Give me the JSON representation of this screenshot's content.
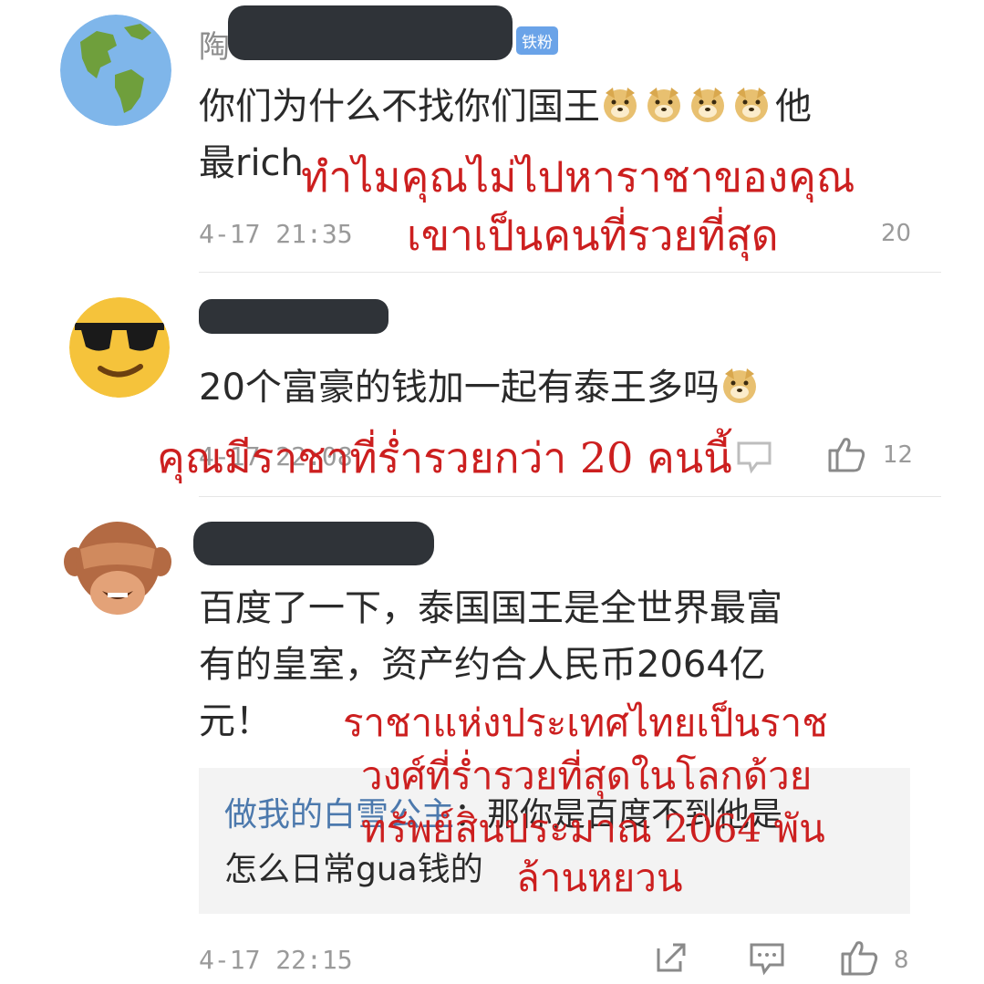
{
  "comments": [
    {
      "name_visible": "陶",
      "badge": "铁粉",
      "text_line1": "你们为什么不找你们国王",
      "text_line1_after": "他",
      "text_line2": "最rich",
      "time": "4-17 21:35",
      "likes": "20",
      "emoji": "doge",
      "translation_line1": "ทำไมคุณไม่ไปหาราชาของคุณ",
      "translation_line2": "เขาเป็นคนที่รวยที่สุด"
    },
    {
      "name_visible": "",
      "text_line1": "20个富豪的钱加一起有泰王多吗",
      "time": "4-17 22:08",
      "likes": "12",
      "emoji": "doge",
      "translation_line1": "คุณมีราชาที่ร่ำรวยกว่า 20 คนนี้"
    },
    {
      "name_visible": "",
      "text_line1": "百度了一下，泰国国王是全世界最富",
      "text_line2": "有的皇室，资产约合人民币2064亿",
      "text_line3": "元！",
      "time": "4-17 22:15",
      "likes": "8",
      "translation_line1": "ราชาแห่งประเทศไทยเป็นราช",
      "translation_line2": "วงศ์ที่ร่ำรวยที่สุดในโลกด้วย",
      "translation_line3": "ทรัพย์สินประมาณ 2064 พัน",
      "translation_line4": "ล้านหยวน",
      "reply": {
        "user": "做我的白雪公主",
        "colon": "：",
        "text_line1": "那你是百度不到他是",
        "text_line2": "怎么日常gua钱的"
      }
    }
  ],
  "colors": {
    "translation": "#cc1f1f",
    "badge": "#6aa3e8",
    "reply_user": "#4c79ad"
  }
}
